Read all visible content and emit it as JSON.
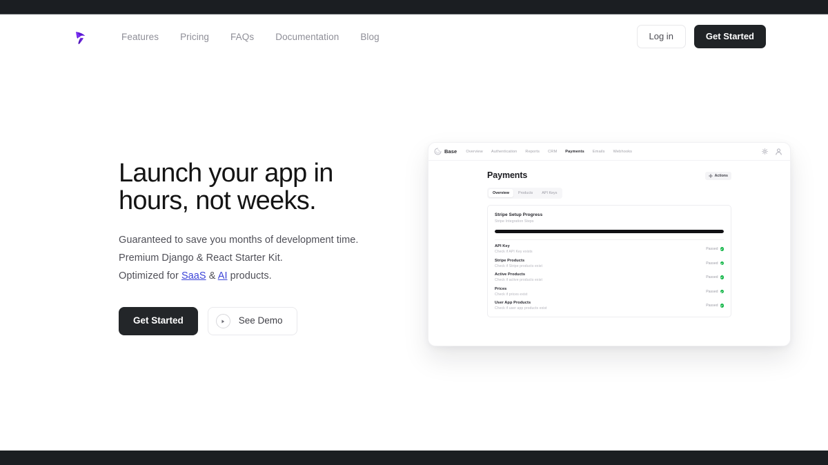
{
  "colors": {
    "chrome_dark": "#1b1e22",
    "accent_purple": "#6d28d9",
    "link_blue": "#3b43d8",
    "button_dark": "#202326",
    "status_green": "#16b74a"
  },
  "navbar": {
    "logo_icon": "bird-logo-icon",
    "links": [
      {
        "label": "Features"
      },
      {
        "label": "Pricing"
      },
      {
        "label": "FAQs"
      },
      {
        "label": "Documentation"
      },
      {
        "label": "Blog"
      }
    ],
    "login_label": "Log in",
    "get_started_label": "Get Started"
  },
  "hero": {
    "title_line_1": "Launch your app in",
    "title_line_2": "hours, not weeks.",
    "sub_line_1": "Guaranteed to save you months of development time.",
    "sub_line_2": "Premium Django & React Starter Kit.",
    "sub_line_3_prefix": "Optimized for ",
    "sub_line_3_link_1": "SaaS",
    "sub_line_3_mid": " & ",
    "sub_line_3_link_2": "AI",
    "sub_line_3_suffix": " products.",
    "primary_cta": "Get Started",
    "secondary_cta": "See Demo",
    "secondary_cta_icon": "play-circle-icon"
  },
  "preview": {
    "topbar": {
      "brand_icon": "base-swirl-logo-icon",
      "brand_name": "Base",
      "nav_items": [
        {
          "label": "Overview",
          "active": false
        },
        {
          "label": "Authentication",
          "active": false
        },
        {
          "label": "Reports",
          "active": false
        },
        {
          "label": "CRM",
          "active": false
        },
        {
          "label": "Payments",
          "active": true
        },
        {
          "label": "Emails",
          "active": false
        },
        {
          "label": "Webhooks",
          "active": false
        }
      ],
      "settings_icon": "gear-icon",
      "avatar_icon": "user-avatar-icon"
    },
    "page_title": "Payments",
    "actions_button": {
      "label": "Actions",
      "icon": "gear-icon"
    },
    "tabs": [
      {
        "label": "Overview",
        "active": true
      },
      {
        "label": "Products",
        "active": false
      },
      {
        "label": "API Keys",
        "active": false
      }
    ],
    "panel": {
      "title": "Stripe Setup Progress",
      "subtitle": "Stripe Integration Steps",
      "progress_percent": 100,
      "checks": [
        {
          "name": "API Key",
          "description": "Check if API Key exists",
          "status": "Passed",
          "status_icon": "check-circle-icon"
        },
        {
          "name": "Stripe Products",
          "description": "Check if Stripe products exist",
          "status": "Passed",
          "status_icon": "check-circle-icon"
        },
        {
          "name": "Active Products",
          "description": "Check if active products exist",
          "status": "Passed",
          "status_icon": "check-circle-icon"
        },
        {
          "name": "Prices",
          "description": "Check if prices exist",
          "status": "Passed",
          "status_icon": "check-circle-icon"
        },
        {
          "name": "User App Products",
          "description": "Check if user app products exist",
          "status": "Passed",
          "status_icon": "check-circle-icon"
        }
      ]
    }
  }
}
